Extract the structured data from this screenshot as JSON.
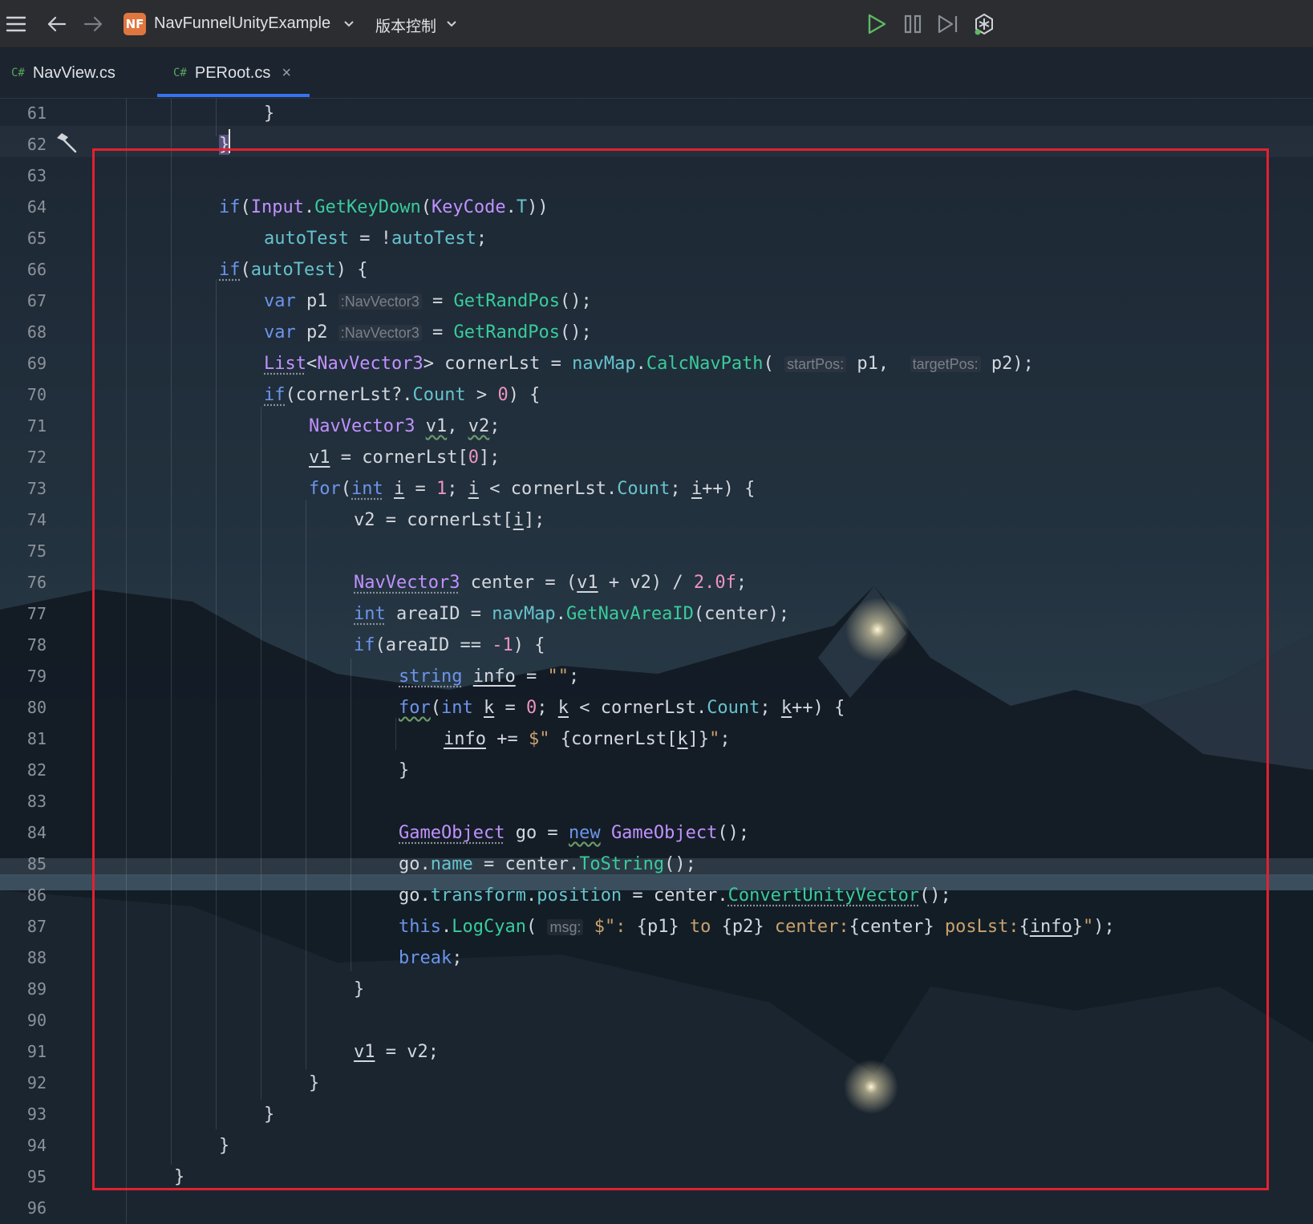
{
  "toolbar": {
    "project_badge": "NF",
    "project_name": "NavFunnelUnityExample",
    "vcs_label": "版本控制",
    "icons": [
      "hamburger-menu-icon",
      "back-arrow-icon",
      "forward-arrow-icon",
      "chevron-down-icon",
      "run-icon",
      "pause-icon",
      "step-icon",
      "debug-icon"
    ]
  },
  "tabs": [
    {
      "lang": "C#",
      "label": "NavView.cs",
      "active": false
    },
    {
      "lang": "C#",
      "label": "PERoot.cs",
      "active": true,
      "closable": true,
      "close_glyph": "×"
    }
  ],
  "editor": {
    "current_line": 62,
    "caret_line": 62,
    "gutter_icon_line": 62,
    "gutter_icon": "hammer-icon",
    "selection_box_color": "#e5202f",
    "lines": [
      {
        "n": "61",
        "text": "            }"
      },
      {
        "n": "62",
        "text": "        }"
      },
      {
        "n": "63",
        "text": ""
      },
      {
        "n": "64",
        "text": "        if(Input.GetKeyDown(KeyCode.T))"
      },
      {
        "n": "65",
        "text": "            autoTest = !autoTest;"
      },
      {
        "n": "66",
        "text": "        if(autoTest) {"
      },
      {
        "n": "67",
        "text": "            var p1 :NavVector3  = GetRandPos();"
      },
      {
        "n": "68",
        "text": "            var p2 :NavVector3  = GetRandPos();"
      },
      {
        "n": "69",
        "text": "            List<NavVector3> cornerLst = navMap.CalcNavPath( startPos: p1,  targetPos: p2);"
      },
      {
        "n": "70",
        "text": "            if(cornerLst?.Count > 0) {"
      },
      {
        "n": "71",
        "text": "                NavVector3 v1, v2;"
      },
      {
        "n": "72",
        "text": "                v1 = cornerLst[0];"
      },
      {
        "n": "73",
        "text": "                for(int i = 1; i < cornerLst.Count; i++) {"
      },
      {
        "n": "74",
        "text": "                    v2 = cornerLst[i];"
      },
      {
        "n": "75",
        "text": ""
      },
      {
        "n": "76",
        "text": "                    NavVector3 center = (v1 + v2) / 2.0f;"
      },
      {
        "n": "77",
        "text": "                    int areaID = navMap.GetNavAreaID(center);"
      },
      {
        "n": "78",
        "text": "                    if(areaID == -1) {"
      },
      {
        "n": "79",
        "text": "                        string info = \"\";"
      },
      {
        "n": "80",
        "text": "                        for(int k = 0; k < cornerLst.Count; k++) {"
      },
      {
        "n": "81",
        "text": "                            info += $\" {cornerLst[k]}\";"
      },
      {
        "n": "82",
        "text": "                        }"
      },
      {
        "n": "83",
        "text": ""
      },
      {
        "n": "84",
        "text": "                        GameObject go = new GameObject();"
      },
      {
        "n": "85",
        "text": "                        go.name = center.ToString();"
      },
      {
        "n": "86",
        "text": "                        go.transform.position = center.ConvertUnityVector();"
      },
      {
        "n": "87",
        "text": "                        this.LogCyan( msg: $\": {p1} to {p2} center:{center} posLst:{info}\");"
      },
      {
        "n": "88",
        "text": "                        break;"
      },
      {
        "n": "89",
        "text": "                    }"
      },
      {
        "n": "90",
        "text": ""
      },
      {
        "n": "91",
        "text": "                    v1 = v2;"
      },
      {
        "n": "92",
        "text": "                }"
      },
      {
        "n": "93",
        "text": "            }"
      },
      {
        "n": "94",
        "text": "        }"
      },
      {
        "n": "95",
        "text": "    }"
      },
      {
        "n": "96",
        "text": ""
      }
    ]
  }
}
